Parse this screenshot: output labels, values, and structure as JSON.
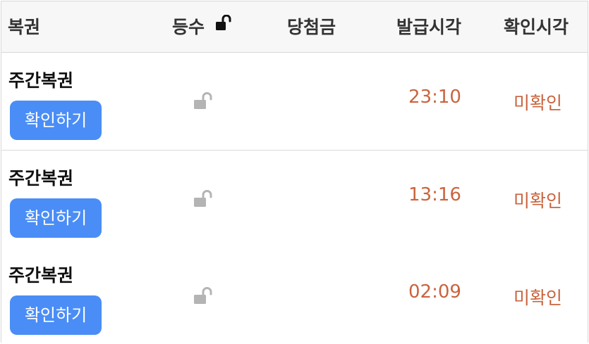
{
  "table": {
    "headers": {
      "type": "복권",
      "rank": "등수",
      "prize": "당첨금",
      "issued_time": "발급시각",
      "checked_time": "확인시각"
    },
    "rows": [
      {
        "lottery": "주간복권",
        "button_label": "확인하기",
        "prize": "",
        "issued_time": "23:10",
        "status": "미확인"
      },
      {
        "lottery": "주간복권",
        "button_label": "확인하기",
        "prize": "",
        "issued_time": "13:16",
        "status": "미확인"
      },
      {
        "lottery": "주간복권",
        "button_label": "확인하기",
        "prize": "",
        "issued_time": "02:09",
        "status": "미확인"
      }
    ]
  },
  "icons": {
    "header_rank_icon": "unlocked-padlock-icon",
    "row_rank_icon": "unlocked-padlock-icon"
  },
  "colors": {
    "button_bg": "#4a8df6",
    "time_text": "#c9643e",
    "status_text": "#c9643e",
    "header_bg": "#f7f7f7"
  }
}
